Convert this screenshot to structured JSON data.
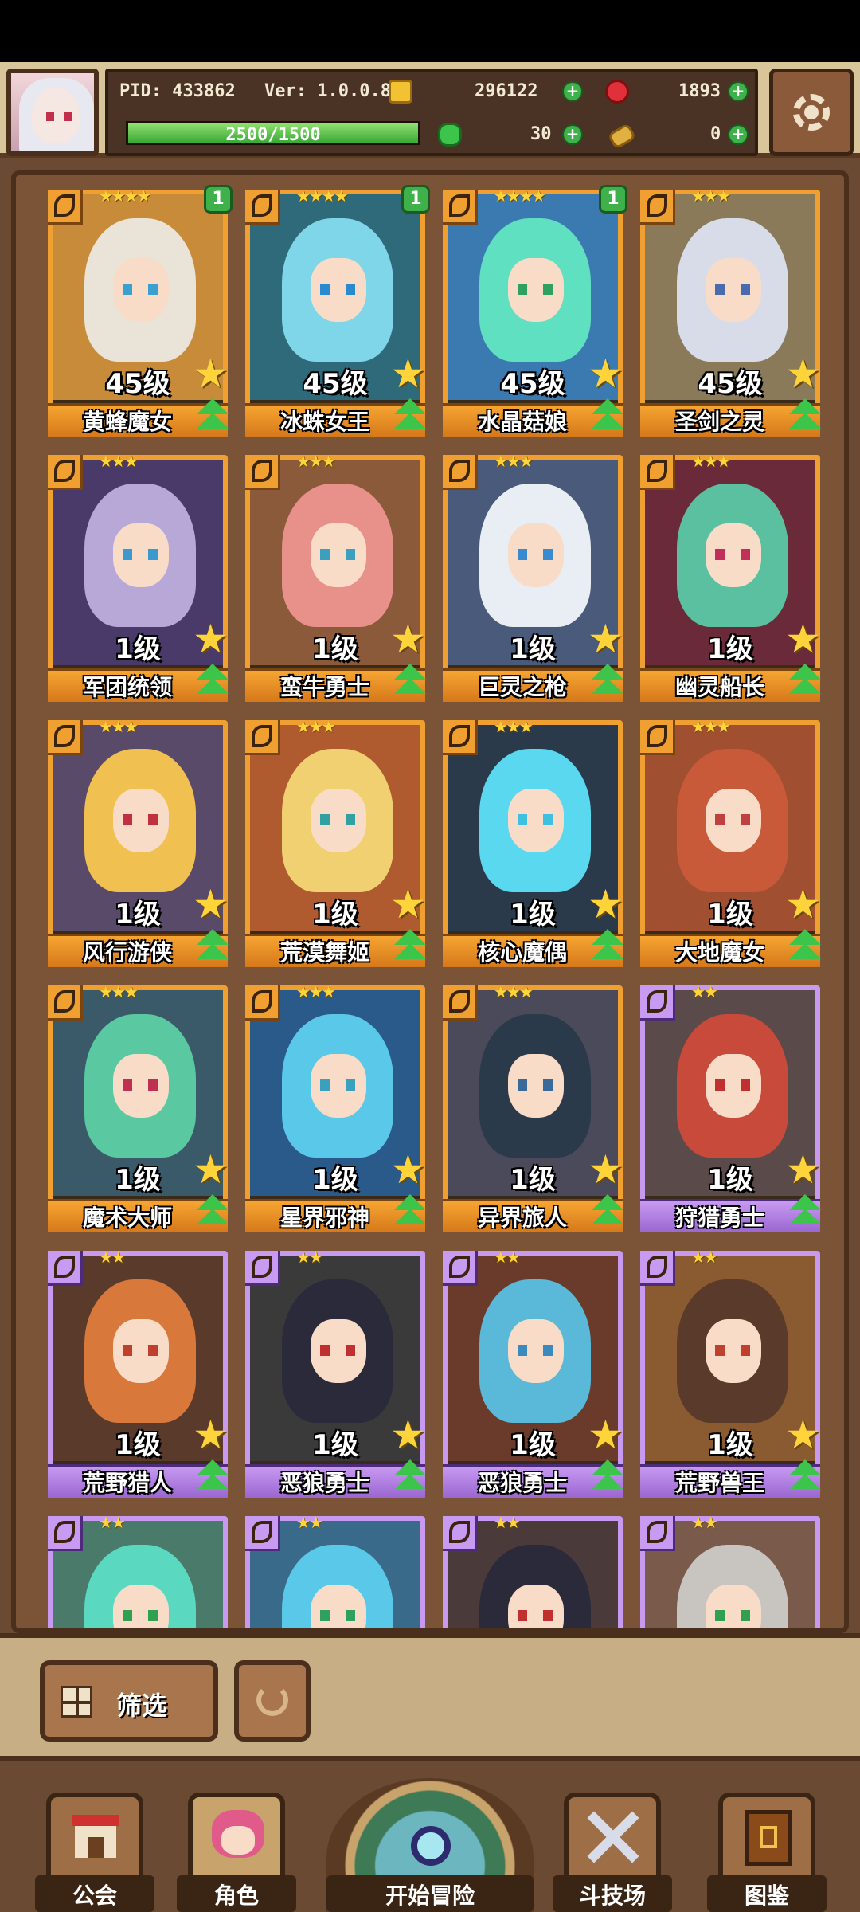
{
  "hud": {
    "pid": "PID: 433862",
    "version": "Ver: 1.0.0.8",
    "gold": "296122",
    "ruby": "1893",
    "exp": "2500/1500",
    "exp_fill": 1.0,
    "clover": "30",
    "bone": "0"
  },
  "characters": [
    {
      "name": "黄蜂魔女",
      "level": "45级",
      "stars": "★★★★",
      "badge": "1",
      "rarity": "gold",
      "hair": "#e9e3d8",
      "bg": "#c78b3a",
      "eye": "#3aa0d0"
    },
    {
      "name": "冰蛛女王",
      "level": "45级",
      "stars": "★★★★",
      "badge": "1",
      "rarity": "gold",
      "hair": "#7ed6e8",
      "bg": "#2f6a7a",
      "eye": "#2a8ad0"
    },
    {
      "name": "水晶菇娘",
      "level": "45级",
      "stars": "★★★★",
      "badge": "1",
      "rarity": "gold",
      "hair": "#5fe0c0",
      "bg": "#3a7ab0",
      "eye": "#30a060"
    },
    {
      "name": "圣剑之灵",
      "level": "45级",
      "stars": "★★★",
      "badge": "",
      "rarity": "gold",
      "hair": "#d8dce8",
      "bg": "#8a7a5a",
      "eye": "#4a6ab0"
    },
    {
      "name": "军团统领",
      "level": "1级",
      "stars": "★★★",
      "badge": "",
      "rarity": "gold",
      "hair": "#b8a8d8",
      "bg": "#4a3a6a",
      "eye": "#3a9ad0"
    },
    {
      "name": "蛮牛勇士",
      "level": "1级",
      "stars": "★★★",
      "badge": "",
      "rarity": "gold",
      "hair": "#e8908a",
      "bg": "#8a5a3a",
      "eye": "#3aa0c0"
    },
    {
      "name": "巨灵之枪",
      "level": "1级",
      "stars": "★★★",
      "badge": "",
      "rarity": "gold",
      "hair": "#e8eef4",
      "bg": "#4a5a7a",
      "eye": "#3a8ad0"
    },
    {
      "name": "幽灵船长",
      "level": "1级",
      "stars": "★★★",
      "badge": "",
      "rarity": "gold",
      "hair": "#5ac0a0",
      "bg": "#6a2a3a",
      "eye": "#c0305a"
    },
    {
      "name": "风行游侠",
      "level": "1级",
      "stars": "★★★",
      "badge": "",
      "rarity": "gold",
      "hair": "#f0c050",
      "bg": "#5a4a6a",
      "eye": "#c03040"
    },
    {
      "name": "荒漠舞姬",
      "level": "1级",
      "stars": "★★★",
      "badge": "",
      "rarity": "gold",
      "hair": "#f0d070",
      "bg": "#b05a30",
      "eye": "#30a0a0"
    },
    {
      "name": "核心魔偶",
      "level": "1级",
      "stars": "★★★",
      "badge": "",
      "rarity": "gold",
      "hair": "#5ad8f0",
      "bg": "#2a3a4a",
      "eye": "#40c0e0"
    },
    {
      "name": "大地魔女",
      "level": "1级",
      "stars": "★★★",
      "badge": "",
      "rarity": "gold",
      "hair": "#c85a3a",
      "bg": "#a05030",
      "eye": "#c04040"
    },
    {
      "name": "魔术大师",
      "level": "1级",
      "stars": "★★★",
      "badge": "",
      "rarity": "gold",
      "hair": "#5ac8a0",
      "bg": "#3a5a6a",
      "eye": "#c03050"
    },
    {
      "name": "星界邪神",
      "level": "1级",
      "stars": "★★★",
      "badge": "",
      "rarity": "gold",
      "hair": "#5ac8e8",
      "bg": "#2a5a8a",
      "eye": "#3aa0c0"
    },
    {
      "name": "异界旅人",
      "level": "1级",
      "stars": "★★★",
      "badge": "",
      "rarity": "gold",
      "hair": "#2a3a4a",
      "bg": "#4a4a5a",
      "eye": "#3a6a9a"
    },
    {
      "name": "狩猎勇士",
      "level": "1级",
      "stars": "★★",
      "badge": "",
      "rarity": "purple",
      "hair": "#c84a3a",
      "bg": "#5a4a4a",
      "eye": "#c03030"
    },
    {
      "name": "荒野猎人",
      "level": "1级",
      "stars": "★★",
      "badge": "",
      "rarity": "purple",
      "hair": "#d8783a",
      "bg": "#5a3a2a",
      "eye": "#c04030"
    },
    {
      "name": "恶狼勇士",
      "level": "1级",
      "stars": "★★",
      "badge": "",
      "rarity": "purple",
      "hair": "#2a2a3a",
      "bg": "#3a3a3a",
      "eye": "#c03030"
    },
    {
      "name": "恶狼勇士",
      "level": "1级",
      "stars": "★★",
      "badge": "",
      "rarity": "purple",
      "hair": "#5ab8d8",
      "bg": "#6a3a2a",
      "eye": "#3a8ac0"
    },
    {
      "name": "荒野兽王",
      "level": "1级",
      "stars": "★★",
      "badge": "",
      "rarity": "purple",
      "hair": "#5a3a2a",
      "bg": "#8a5a30",
      "eye": "#c04030"
    },
    {
      "name": "",
      "level": "",
      "stars": "★★",
      "badge": "",
      "rarity": "purple",
      "hair": "#5ad8c0",
      "bg": "#4a7a6a",
      "eye": "#30a050"
    },
    {
      "name": "",
      "level": "",
      "stars": "★★",
      "badge": "",
      "rarity": "purple",
      "hair": "#5ac8e8",
      "bg": "#3a6a8a",
      "eye": "#30a060"
    },
    {
      "name": "",
      "level": "",
      "stars": "★★",
      "badge": "",
      "rarity": "purple",
      "hair": "#2a2a3a",
      "bg": "#4a3a3a",
      "eye": "#c03030"
    },
    {
      "name": "",
      "level": "",
      "stars": "★★",
      "badge": "",
      "rarity": "purple",
      "hair": "#c8c4c0",
      "bg": "#7a5a4a",
      "eye": "#30a050"
    }
  ],
  "filter": {
    "label": "筛选"
  },
  "nav": {
    "guild": "公会",
    "character": "角色",
    "adventure": "开始冒险",
    "arena": "斗技场",
    "codex": "图鉴"
  },
  "colors": {
    "gold_frame": "#f0a030",
    "purple_frame": "#c79af0",
    "accent_green": "#3fb14a"
  }
}
